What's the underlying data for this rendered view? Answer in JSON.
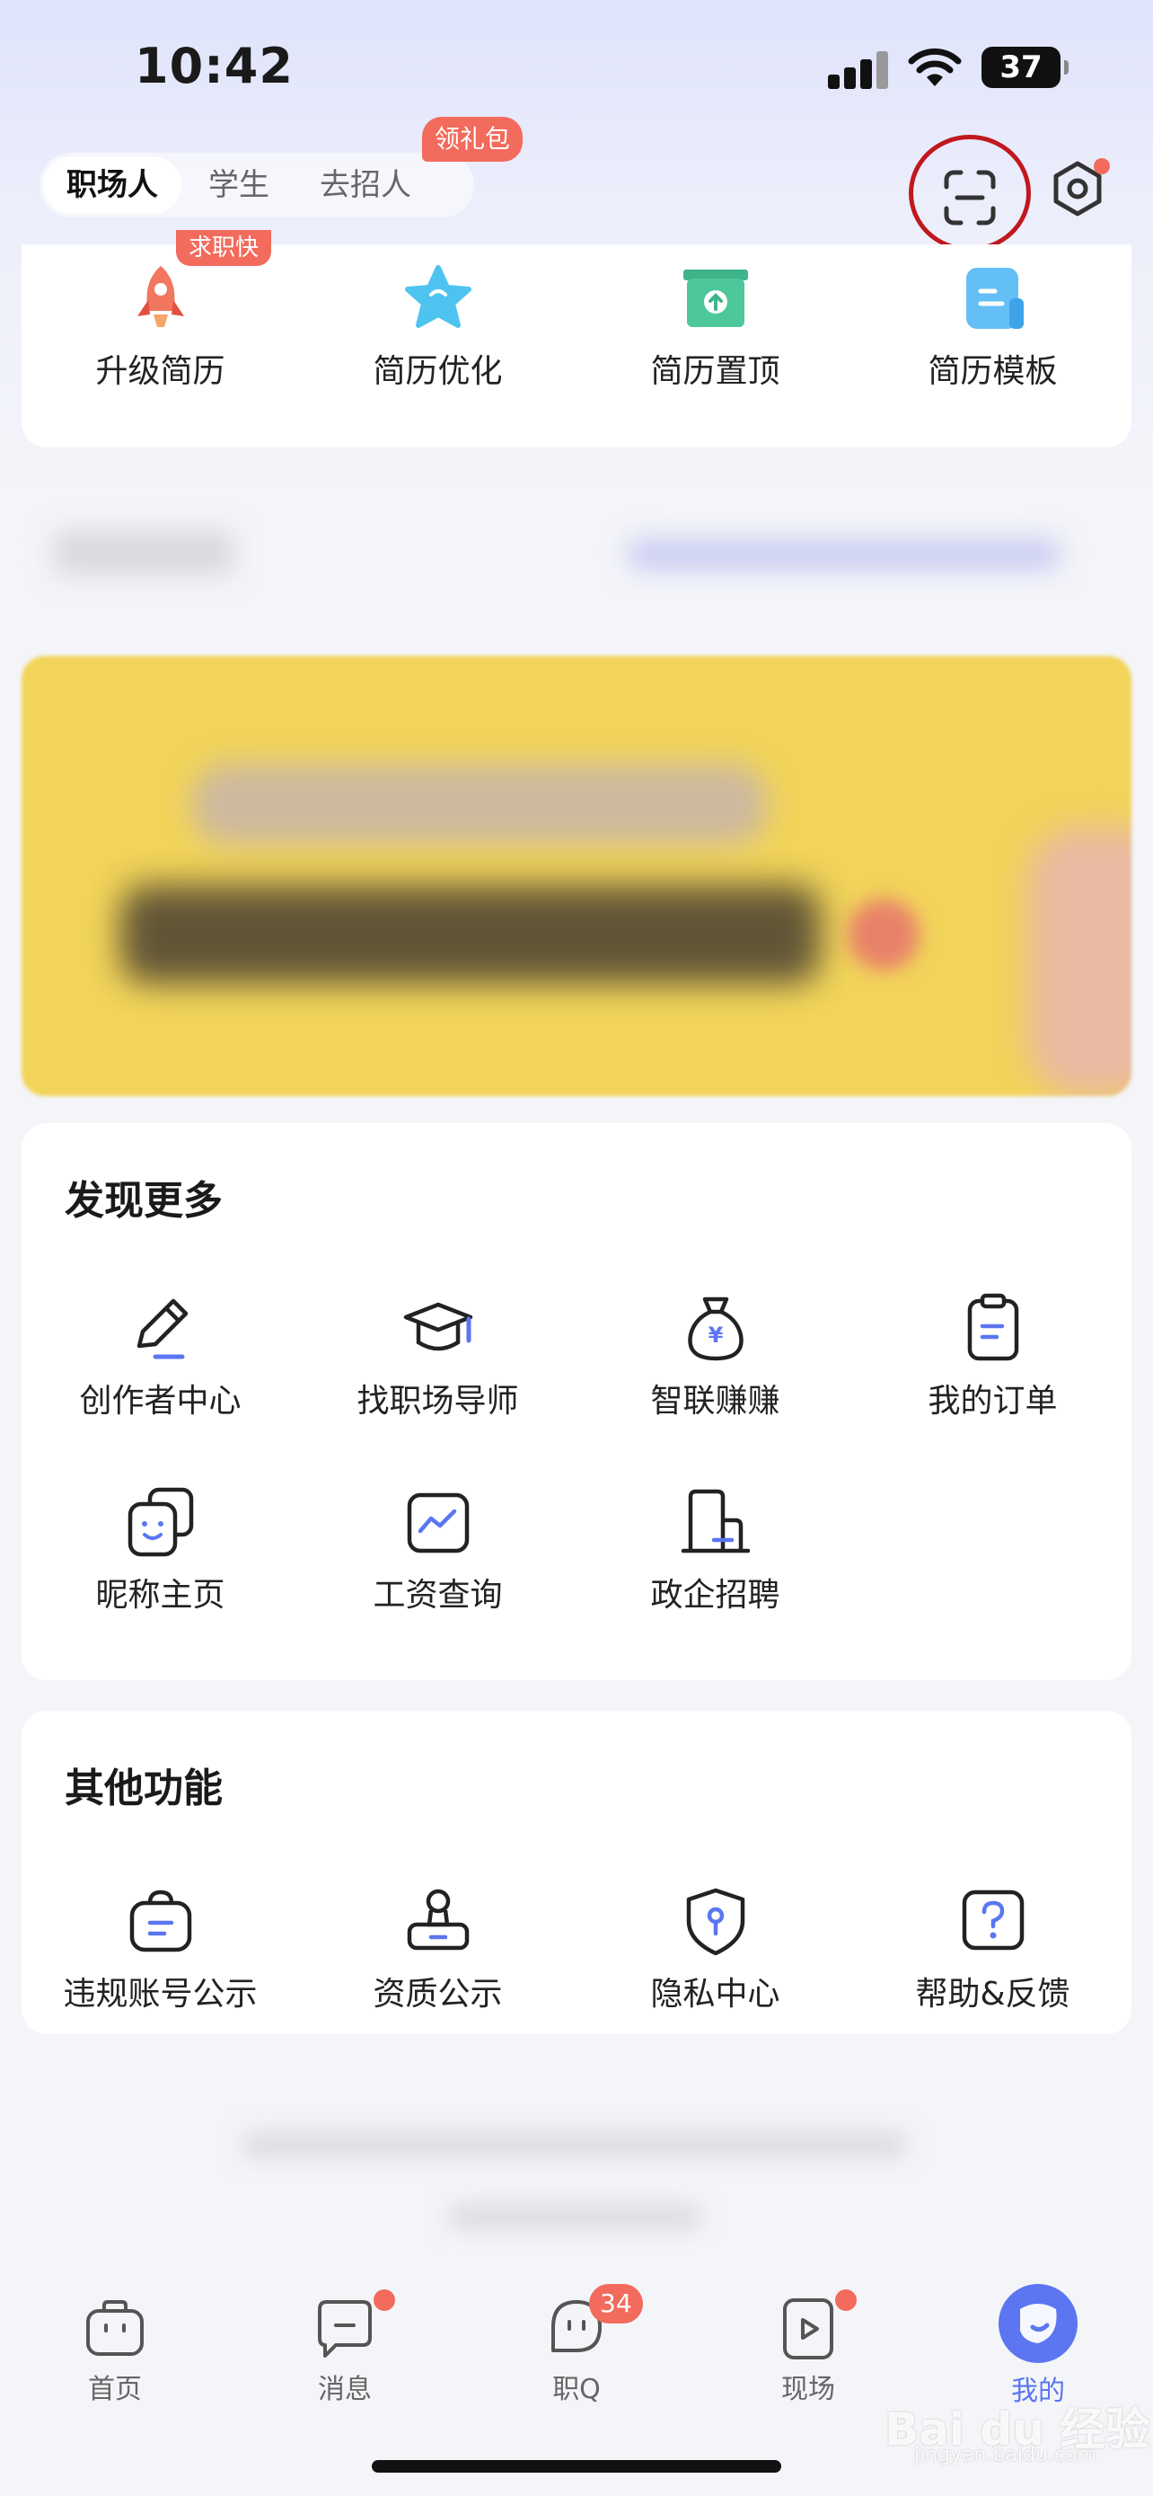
{
  "status_bar": {
    "time": "10:42",
    "battery": "37"
  },
  "header": {
    "role_tabs": [
      {
        "label": "职场人",
        "active": true
      },
      {
        "label": "学生",
        "active": false
      },
      {
        "label": "去招人",
        "active": false
      }
    ],
    "gift_badge": "领礼包",
    "scan_icon": "scan-icon",
    "settings_icon": "settings-icon"
  },
  "resume_tools": {
    "badge": "求职快",
    "items": [
      {
        "label": "升级简历",
        "icon": "rocket-icon"
      },
      {
        "label": "简历优化",
        "icon": "star-icon"
      },
      {
        "label": "简历置顶",
        "icon": "top-box-icon"
      },
      {
        "label": "简历模板",
        "icon": "template-icon"
      }
    ]
  },
  "discover": {
    "title": "发现更多",
    "items": [
      {
        "label": "创作者中心",
        "icon": "pencil-icon"
      },
      {
        "label": "找职场导师",
        "icon": "graduation-cap-icon"
      },
      {
        "label": "智联赚赚",
        "icon": "money-bag-icon"
      },
      {
        "label": "我的订单",
        "icon": "clipboard-icon"
      },
      {
        "label": "昵称主页",
        "icon": "face-card-icon"
      },
      {
        "label": "工资查询",
        "icon": "trend-chart-icon"
      },
      {
        "label": "政企招聘",
        "icon": "building-icon"
      }
    ]
  },
  "other": {
    "title": "其他功能",
    "items": [
      {
        "label": "违规账号公示",
        "icon": "bag-icon"
      },
      {
        "label": "资质公示",
        "icon": "stamp-icon"
      },
      {
        "label": "隐私中心",
        "icon": "shield-icon"
      },
      {
        "label": "帮助&反馈",
        "icon": "question-icon"
      }
    ]
  },
  "tab_bar": {
    "items": [
      {
        "label": "首页",
        "icon": "briefcase-icon"
      },
      {
        "label": "消息",
        "icon": "chat-icon"
      },
      {
        "label": "职Q",
        "icon": "ghost-chat-icon"
      },
      {
        "label": "现场",
        "icon": "video-icon"
      },
      {
        "label": "我的",
        "icon": "profile-icon"
      }
    ],
    "q_count": "34"
  },
  "watermark": {
    "main": "Bai du 经验",
    "sub": "jingyan.baidu.com"
  },
  "colors": {
    "accent": "#5b76f0",
    "badge": "#f26b5c",
    "highlight_circle": "#c0181e"
  }
}
